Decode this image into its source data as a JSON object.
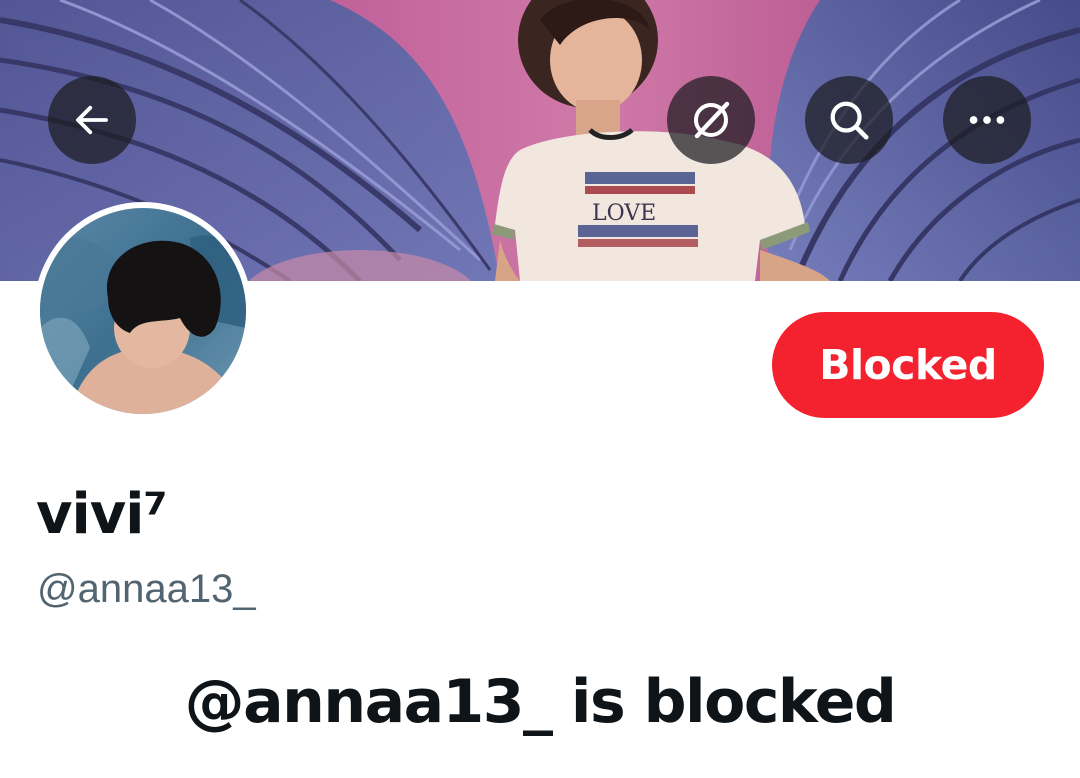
{
  "header": {
    "back_icon": "arrow-left-icon",
    "grok_icon": "grok-slash-icon",
    "search_icon": "search-icon",
    "more_icon": "more-horizontal-icon"
  },
  "banner": {
    "shirt_text": "LOVE"
  },
  "profile": {
    "display_name": "vivi⁷",
    "handle": "@annaa13_",
    "blocked_button_label": "Blocked",
    "blocked_message": "@annaa13_ is blocked"
  },
  "colors": {
    "blocked_button": "#f4212e",
    "primary_text": "#0f1419",
    "secondary_text": "#536471",
    "icon_button_bg": "#1c1c20"
  }
}
